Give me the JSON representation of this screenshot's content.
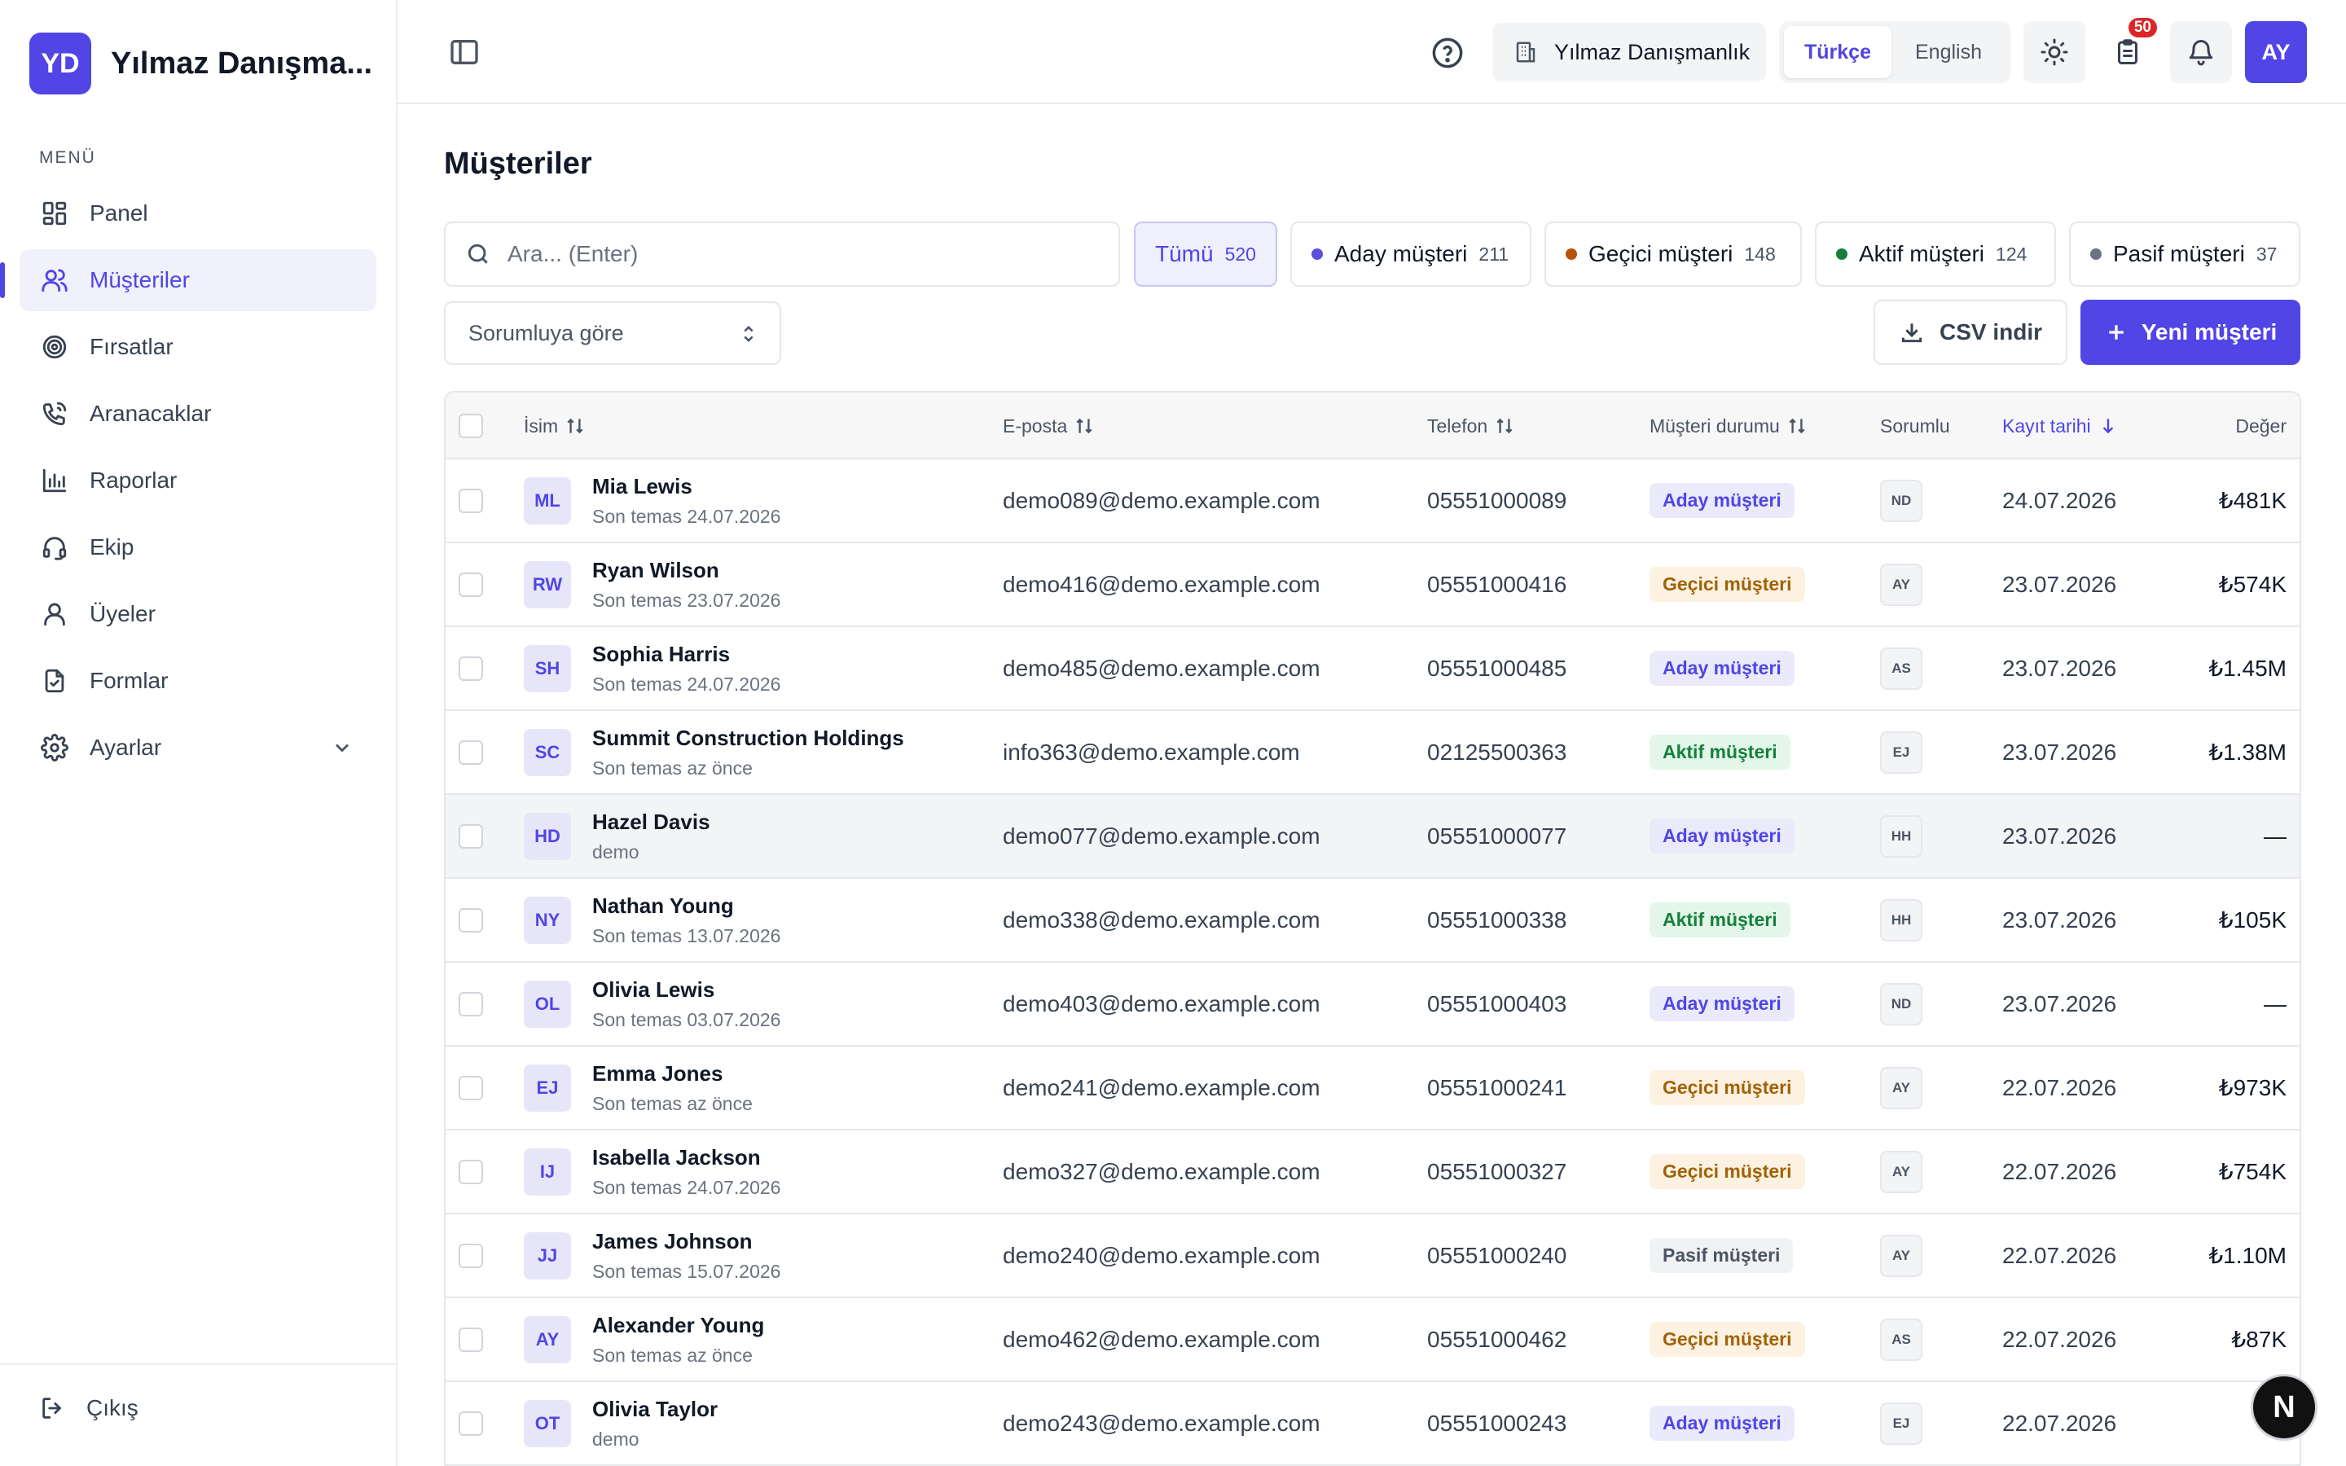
{
  "brand": {
    "initials": "YD",
    "name": "Yılmaz Danışma..."
  },
  "menu_label": "MENÜ",
  "nav": [
    {
      "label": "Panel",
      "icon": "dashboard-icon",
      "active": false
    },
    {
      "label": "Müşteriler",
      "icon": "users-icon",
      "active": true
    },
    {
      "label": "Fırsatlar",
      "icon": "target-icon",
      "active": false
    },
    {
      "label": "Aranacaklar",
      "icon": "phone-icon",
      "active": false
    },
    {
      "label": "Raporlar",
      "icon": "chart-icon",
      "active": false
    },
    {
      "label": "Ekip",
      "icon": "headset-icon",
      "active": false
    },
    {
      "label": "Üyeler",
      "icon": "user-icon",
      "active": false
    },
    {
      "label": "Formlar",
      "icon": "form-icon",
      "active": false
    },
    {
      "label": "Ayarlar",
      "icon": "gear-icon",
      "active": false
    }
  ],
  "logout_label": "Çıkış",
  "topbar": {
    "company": "Yılmaz Danışmanlık",
    "lang_tr": "Türkçe",
    "lang_en": "English",
    "tasks_badge": "50",
    "user_initials": "AY"
  },
  "page_title": "Müşteriler",
  "search": {
    "placeholder": "Ara... (Enter)"
  },
  "filters": [
    {
      "label": "Tümü",
      "count": "520",
      "dot": ""
    },
    {
      "label": "Aday müşteri",
      "count": "211",
      "dot": "#5b4fe0"
    },
    {
      "label": "Geçici müşteri",
      "count": "148",
      "dot": "#b45309"
    },
    {
      "label": "Aktif müşteri",
      "count": "124",
      "dot": "#15803d"
    },
    {
      "label": "Pasif müşteri",
      "count": "37",
      "dot": "#6b7280"
    }
  ],
  "owner_filter": "Sorumluya göre",
  "csv_label": "CSV indir",
  "new_label": "Yeni müşteri",
  "columns": {
    "name": "İsim",
    "email": "E-posta",
    "phone": "Telefon",
    "status": "Müşteri durumu",
    "owner": "Sorumlu",
    "date": "Kayıt tarihi",
    "value": "Değer"
  },
  "status_colors": {
    "Aday müşteri": {
      "bg": "#ebeafb",
      "fg": "#4f46e5"
    },
    "Geçici müşteri": {
      "bg": "#fdf1e1",
      "fg": "#a16207"
    },
    "Aktif müşteri": {
      "bg": "#e3f6e8",
      "fg": "#15803d"
    },
    "Pasif müşteri": {
      "bg": "#f1f2f4",
      "fg": "#4b5563"
    }
  },
  "rows": [
    {
      "initials": "ML",
      "name": "Mia Lewis",
      "sub": "Son temas 24.07.2026",
      "email": "demo089@demo.example.com",
      "phone": "05551000089",
      "status": "Aday müşteri",
      "owner": "ND",
      "date": "24.07.2026",
      "value": "₺481K"
    },
    {
      "initials": "RW",
      "name": "Ryan Wilson",
      "sub": "Son temas 23.07.2026",
      "email": "demo416@demo.example.com",
      "phone": "05551000416",
      "status": "Geçici müşteri",
      "owner": "AY",
      "date": "23.07.2026",
      "value": "₺574K"
    },
    {
      "initials": "SH",
      "name": "Sophia Harris",
      "sub": "Son temas 24.07.2026",
      "email": "demo485@demo.example.com",
      "phone": "05551000485",
      "status": "Aday müşteri",
      "owner": "AS",
      "date": "23.07.2026",
      "value": "₺1.45M"
    },
    {
      "initials": "SC",
      "name": "Summit Construction Holdings",
      "sub": "Son temas az önce",
      "email": "info363@demo.example.com",
      "phone": "02125500363",
      "status": "Aktif müşteri",
      "owner": "EJ",
      "date": "23.07.2026",
      "value": "₺1.38M"
    },
    {
      "initials": "HD",
      "name": "Hazel Davis",
      "sub": "demo",
      "email": "demo077@demo.example.com",
      "phone": "05551000077",
      "status": "Aday müşteri",
      "owner": "HH",
      "date": "23.07.2026",
      "value": "—"
    },
    {
      "initials": "NY",
      "name": "Nathan Young",
      "sub": "Son temas 13.07.2026",
      "email": "demo338@demo.example.com",
      "phone": "05551000338",
      "status": "Aktif müşteri",
      "owner": "HH",
      "date": "23.07.2026",
      "value": "₺105K"
    },
    {
      "initials": "OL",
      "name": "Olivia Lewis",
      "sub": "Son temas 03.07.2026",
      "email": "demo403@demo.example.com",
      "phone": "05551000403",
      "status": "Aday müşteri",
      "owner": "ND",
      "date": "23.07.2026",
      "value": "—"
    },
    {
      "initials": "EJ",
      "name": "Emma Jones",
      "sub": "Son temas az önce",
      "email": "demo241@demo.example.com",
      "phone": "05551000241",
      "status": "Geçici müşteri",
      "owner": "AY",
      "date": "22.07.2026",
      "value": "₺973K"
    },
    {
      "initials": "IJ",
      "name": "Isabella Jackson",
      "sub": "Son temas 24.07.2026",
      "email": "demo327@demo.example.com",
      "phone": "05551000327",
      "status": "Geçici müşteri",
      "owner": "AY",
      "date": "22.07.2026",
      "value": "₺754K"
    },
    {
      "initials": "JJ",
      "name": "James Johnson",
      "sub": "Son temas 15.07.2026",
      "email": "demo240@demo.example.com",
      "phone": "05551000240",
      "status": "Pasif müşteri",
      "owner": "AY",
      "date": "22.07.2026",
      "value": "₺1.10M"
    },
    {
      "initials": "AY",
      "name": "Alexander Young",
      "sub": "Son temas az önce",
      "email": "demo462@demo.example.com",
      "phone": "05551000462",
      "status": "Geçici müşteri",
      "owner": "AS",
      "date": "22.07.2026",
      "value": "₺87K"
    },
    {
      "initials": "OT",
      "name": "Olivia Taylor",
      "sub": "demo",
      "email": "demo243@demo.example.com",
      "phone": "05551000243",
      "status": "Aday müşteri",
      "owner": "EJ",
      "date": "22.07.2026",
      "value": ""
    }
  ],
  "hover_row": 4,
  "fab_label": "N"
}
